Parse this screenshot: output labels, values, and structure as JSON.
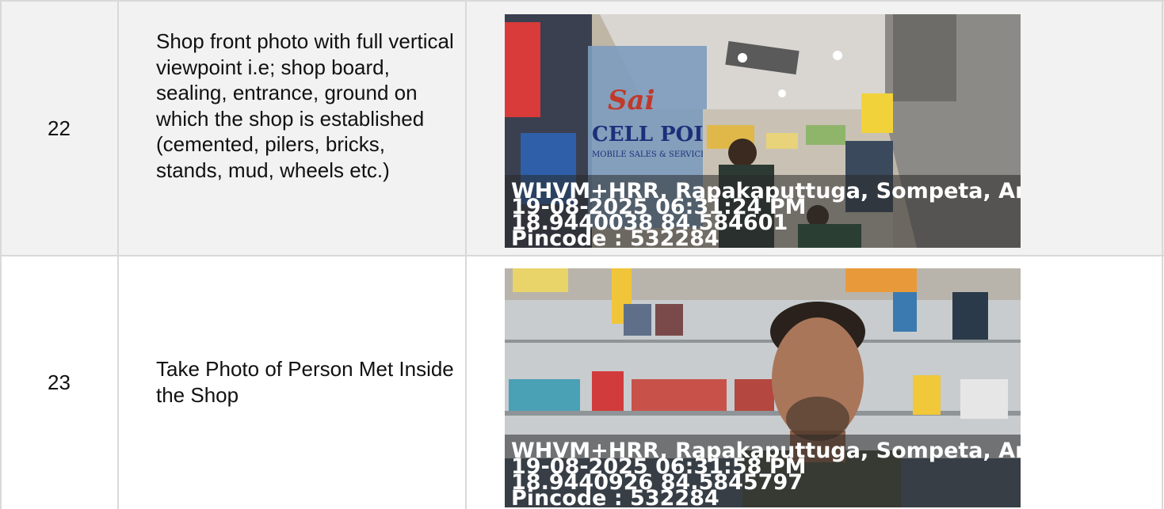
{
  "rows": [
    {
      "number": "22",
      "description": "Shop front photo with full vertical viewpoint i.e; shop board, sealing, entrance, ground on which the shop is established (cemented, pilers, bricks, stands, mud, wheels etc.)",
      "photo": {
        "subject": "shop-front",
        "sign_text": [
          "Sai",
          "CELL POINT",
          "MOBILE SALES & SERVICING"
        ],
        "stamp": {
          "address": "WHVM+HRR, Rapakaputtuga, Sompeta, Andl",
          "datetime": "19-08-2025 06:31:24 PM",
          "coordinates": "18.9440038 84.584601",
          "pincode": "Pincode : 532284"
        }
      }
    },
    {
      "number": "23",
      "description": "Take Photo of Person Met Inside the Shop",
      "photo": {
        "subject": "person-selfie",
        "stamp": {
          "address": "WHVM+HRR, Rapakaputtuga, Sompeta, Andl",
          "datetime": "19-08-2025 06:31:58 PM",
          "coordinates": "18.9440926 84.5845797",
          "pincode": "Pincode : 532284"
        }
      }
    }
  ]
}
